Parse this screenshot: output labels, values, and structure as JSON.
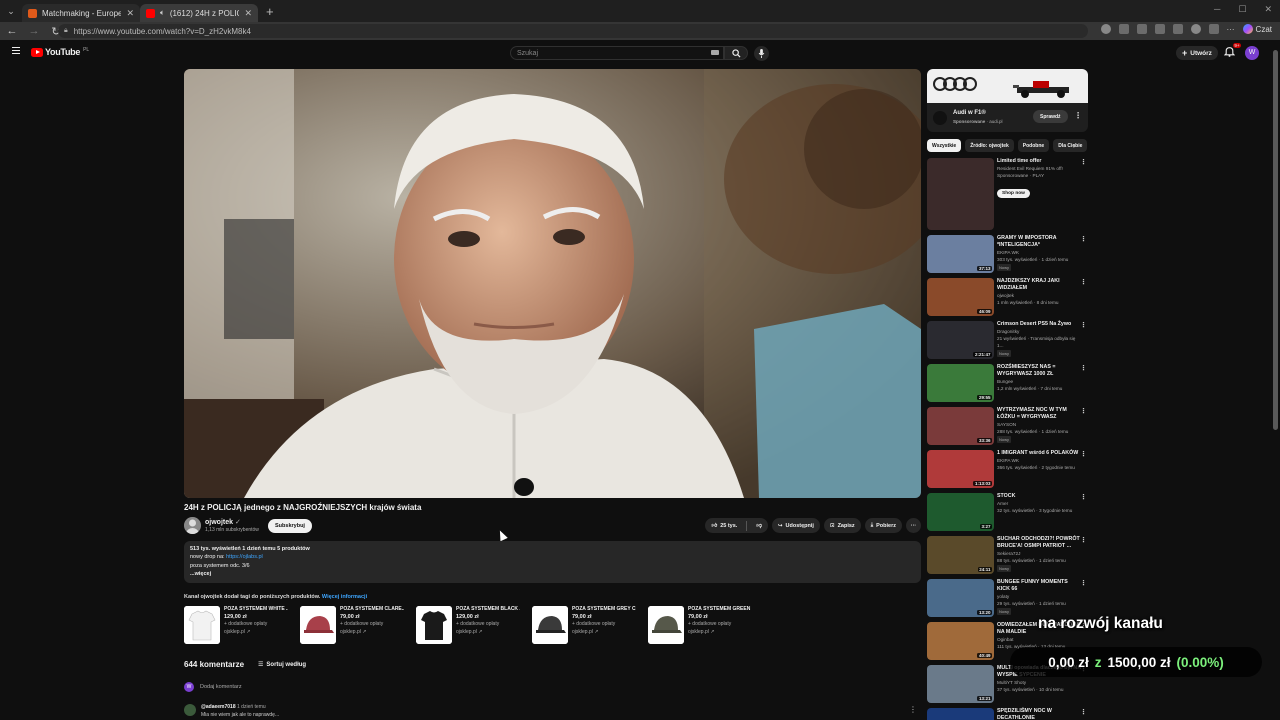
{
  "browser": {
    "tabs": [
      {
        "title": "Matchmaking - Europe 5v5 Queue",
        "active": false
      },
      {
        "title": "(1612) 24H z POLICJĄ jedneg",
        "active": true
      }
    ],
    "url": "https://www.youtube.com/watch?v=D_zH2vkM8k4",
    "copilot": "Czat",
    "colors": {
      "tab_active": "#3b3b3b",
      "toolbar": "#353535"
    }
  },
  "youtube": {
    "logo": "YouTube",
    "logo_region": "PL",
    "search_placeholder": "Szukaj",
    "create_label": "Utwórz",
    "notifications": "9+",
    "avatar_letter": "W",
    "accent": "#ff0000"
  },
  "video": {
    "title": "24H z POLICJĄ jednego z NAJGROŹNIEJSZYCH krajów świata",
    "channel": "ojwojtek",
    "subscribers": "1,13 mln subskrybentów",
    "subscribe_label": "Subskrybuj",
    "likes": "25 tys.",
    "share_label": "Udostępnij",
    "save_label": "Zapisz",
    "download_label": "Pobierz"
  },
  "description": {
    "meta": "513 tys. wyświetleń  1 dzień temu  5 produktów",
    "line1_prefix": "nowy drop na: ",
    "line1_link": "https://ojlabs.pl",
    "line2": "poza systemem odc. 3/6",
    "more": "...więcej"
  },
  "merch": {
    "heading": "Kanał ojwojtek dodał tagi do poniższych produktów.",
    "heading_link": "Więcej informacji",
    "products": [
      {
        "name": "POZA SYSTEMEM WHITE ...",
        "price": "129,00 zł",
        "fees": "+ dodatkowe opłaty",
        "shop": "ojsklep.pl ↗",
        "color": "#f2f2f2"
      },
      {
        "name": "POZA SYSTEMEM CLARE...",
        "price": "79,00 zł",
        "fees": "+ dodatkowe opłaty",
        "shop": "ojsklep.pl ↗",
        "color": "#a8404a"
      },
      {
        "name": "POZA SYSTEMEM BLACK ...",
        "price": "129,00 zł",
        "fees": "+ dodatkowe opłaty",
        "shop": "ojsklep.pl ↗",
        "color": "#1a1a1a"
      },
      {
        "name": "POZA SYSTEMEM GREY C...",
        "price": "79,00 zł",
        "fees": "+ dodatkowe opłaty",
        "shop": "ojsklep.pl ↗",
        "color": "#3a3a3a"
      },
      {
        "name": "POZA SYSTEMEM GREEN ...",
        "price": "79,00 zł",
        "fees": "+ dodatkowe opłaty",
        "shop": "ojsklep.pl ↗",
        "color": "#56584a"
      }
    ]
  },
  "comments": {
    "count": "644 komentarze",
    "sort_label": "Sortuj według",
    "add_placeholder": "Dodaj komentarz",
    "first": {
      "user": "@adaeem7018",
      "when": "1 dzień temu",
      "text": "Mia nie wiem jak ale to naprawdę..."
    }
  },
  "sidebar": {
    "ad": {
      "title": "Audi w F1®",
      "sponsored": "Sponsorowane",
      "domain": "audi.pl",
      "button": "Sprawdź"
    },
    "chips": [
      "Wszystkie",
      "Źródło: ojwojtek",
      "Podobne",
      "Dla Ciebie"
    ],
    "items": [
      {
        "title": "Limited time offer",
        "channel": "Resident Evil Requiem 91% off!",
        "stats": "Sponsorowane · PLAY",
        "duration": "",
        "badge": "",
        "button": "Shop now",
        "thumb": "#3b2a2a"
      },
      {
        "title": "GRAMY W IMPOSTORA *INTELIGENCJA*",
        "channel": "EKIPA WK",
        "stats": "303 tys. wyświetleń · 1 dzień temu",
        "duration": "37:13",
        "badge": "Nowy",
        "thumb": "#6b7fa0"
      },
      {
        "title": "NAJDZIKSZY KRAJ JAKI WIDZIAŁEM",
        "channel": "ojwojtek",
        "stats": "1 mln wyświetleń · 8 dni temu",
        "duration": "46:09",
        "badge": "",
        "thumb": "#8a4a2a"
      },
      {
        "title": "Crimson Desert PS5 Na Żywo",
        "channel": "Dragonitky",
        "stats": "21 wyświetleń · Transmisja odbyła się 1...",
        "duration": "2:21:47",
        "badge": "Nowy",
        "thumb": "#2a2a30"
      },
      {
        "title": "ROZŚMIESZYSZ NAS = WYGRYWASZ 1000 ZŁ",
        "channel": "Bungee",
        "stats": "1,2 mln wyświetleń · 7 dni temu",
        "duration": "29:55",
        "badge": "",
        "thumb": "#3a7a3a"
      },
      {
        "title": "WYTRZYMASZ NOC W TYM ŁÓŻKU = WYGRYWASZ",
        "channel": "SAYSON",
        "stats": "288 tys. wyświetleń · 1 dzień temu",
        "duration": "33:36",
        "badge": "Nowy",
        "thumb": "#7a3a3a"
      },
      {
        "title": "1 IMIGRANT wśród 6 POLAKÓW",
        "channel": "EKIPA WK",
        "stats": "366 tys. wyświetleń · 2 tygodnie temu",
        "duration": "1:13:03",
        "badge": "",
        "thumb": "#b03a3a"
      },
      {
        "title": "STOCK",
        "channel": "Amer",
        "stats": "32 tys. wyświetleń · 3 tygodnie temu",
        "duration": "3:27",
        "badge": "",
        "thumb": "#1e5a2e"
      },
      {
        "title": "SUCHAR ODCHODZI?! POWRÓT BRUCE'A! OSMPI PATRIOT ...",
        "channel": "Sekiera72J",
        "stats": "88 tys. wyświetleń · 1 dzień temu",
        "duration": "24:11",
        "badge": "Nowy",
        "thumb": "#5a4a2a"
      },
      {
        "title": "BUNGEE FUNNY MOMENTS KICK 66",
        "channel": "yolaty",
        "stats": "29 tys. wyświetleń · 1 dzień temu",
        "duration": "13:20",
        "badge": "Nowy",
        "thumb": "#4a6a8a"
      },
      {
        "title": "ODWIEDZAŁEM DOM MARDONA NA MALDIE",
        "channel": "Oginbat",
        "stats": "111 tys. wyświetleń · 13 dni temu",
        "duration": "40:49",
        "badge": "",
        "thumb": "#a06a3a"
      },
      {
        "title": "MULTI opowiada dlaczego był NA WYSPIE SYPCENIE",
        "channel": "MultiYT Shoty",
        "stats": "37 tys. wyświetleń · 10 dni temu",
        "duration": "13:21",
        "badge": "",
        "thumb": "#6a7a8a"
      },
      {
        "title": "SPĘDZILIŚMY NOC W DECATHLONIE",
        "channel": "",
        "stats": "",
        "duration": "",
        "badge": "",
        "thumb": "#1a3a7a"
      }
    ]
  },
  "overlay": {
    "title": "na rozwój kanału",
    "current": "0,00 zł",
    "separator": "z",
    "goal": "1500,00 zł",
    "percent": "(0.00%)",
    "progress_fraction": 0.0
  }
}
